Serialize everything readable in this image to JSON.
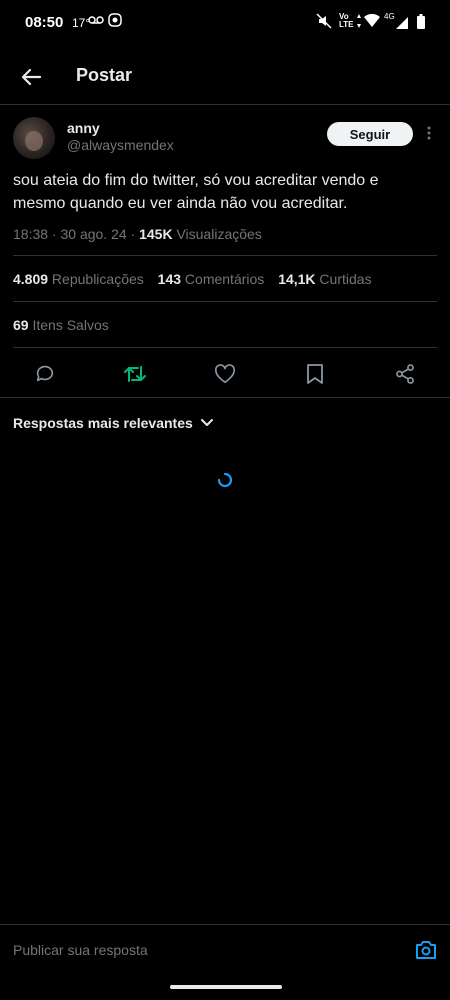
{
  "status_bar": {
    "time": "08:50",
    "temperature": "17°",
    "network_label": "Vo\nLTE",
    "signal_label": "4G"
  },
  "header": {
    "title": "Postar"
  },
  "post": {
    "author_name": "anny",
    "author_handle": "@alwaysmendex",
    "follow_label": "Seguir",
    "text": "sou ateia do fim do twitter, só vou acreditar vendo e mesmo quando eu ver ainda não vou acreditar.",
    "timestamp": "18:38 · 30 ago. 24 · ",
    "views_count": "145K",
    "views_label": " Visualizações",
    "reposts_count": "4.809",
    "reposts_label": " Republicações",
    "comments_count": "143",
    "comments_label": " Comentários",
    "likes_count": "14,1K",
    "likes_label": " Curtidas",
    "saves_count": "69",
    "saves_label": " Itens Salvos"
  },
  "replies": {
    "sort_label": "Respostas mais relevantes"
  },
  "composer": {
    "placeholder": "Publicar sua resposta"
  },
  "colors": {
    "background": "#000000",
    "text_primary": "#e7e9ea",
    "text_secondary": "#71767b",
    "repost_green": "#00ba7c",
    "accent_blue": "#1d9bf0"
  }
}
